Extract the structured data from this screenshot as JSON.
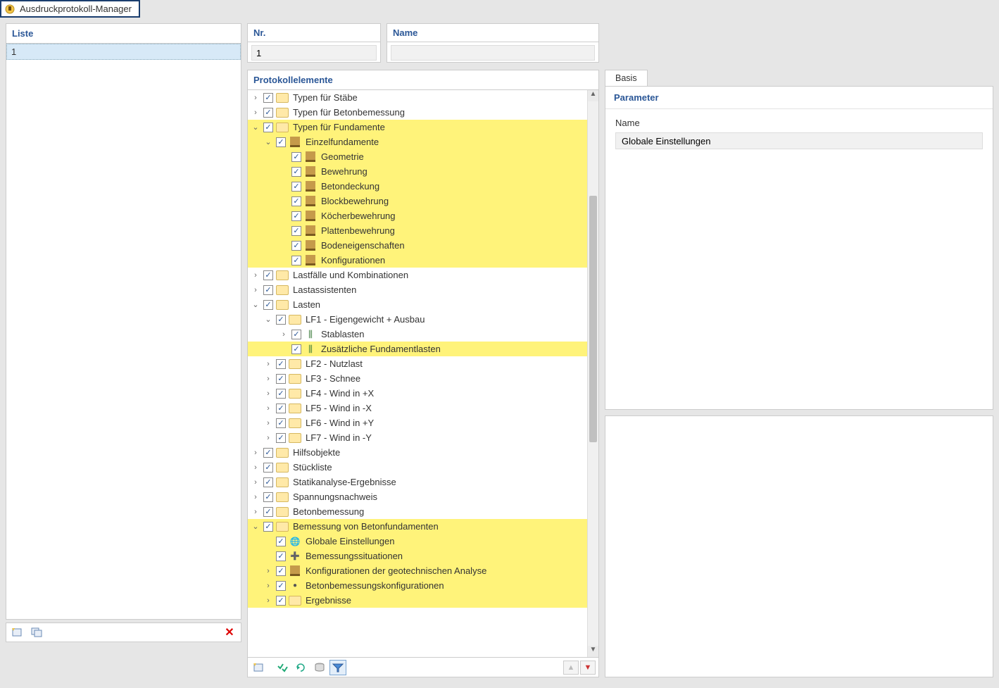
{
  "window": {
    "title": "Ausdruckprotokoll-Manager"
  },
  "liste": {
    "header": "Liste",
    "items": [
      "1"
    ]
  },
  "mid": {
    "nr_header": "Nr.",
    "nr_value": "1",
    "name_header": "Name",
    "name_value": ""
  },
  "proto": {
    "header": "Protokollelemente",
    "tree": [
      {
        "lvl": 0,
        "twist": ">",
        "ico": "folder",
        "label": "Typen für Stäbe",
        "hl": false
      },
      {
        "lvl": 0,
        "twist": ">",
        "ico": "folder",
        "label": "Typen für Betonbemessung",
        "hl": false
      },
      {
        "lvl": 0,
        "twist": "v",
        "ico": "folder",
        "label": "Typen für Fundamente",
        "hl": true
      },
      {
        "lvl": 1,
        "twist": "v",
        "ico": "found",
        "label": "Einzelfundamente",
        "hl": true
      },
      {
        "lvl": 2,
        "twist": " ",
        "ico": "found",
        "label": "Geometrie",
        "hl": true
      },
      {
        "lvl": 2,
        "twist": " ",
        "ico": "found",
        "label": "Bewehrung",
        "hl": true
      },
      {
        "lvl": 2,
        "twist": " ",
        "ico": "found",
        "label": "Betondeckung",
        "hl": true
      },
      {
        "lvl": 2,
        "twist": " ",
        "ico": "found",
        "label": "Blockbewehrung",
        "hl": true
      },
      {
        "lvl": 2,
        "twist": " ",
        "ico": "found",
        "label": "Köcherbewehrung",
        "hl": true
      },
      {
        "lvl": 2,
        "twist": " ",
        "ico": "found",
        "label": "Plattenbewehrung",
        "hl": true
      },
      {
        "lvl": 2,
        "twist": " ",
        "ico": "found",
        "label": "Bodeneigenschaften",
        "hl": true
      },
      {
        "lvl": 2,
        "twist": " ",
        "ico": "found",
        "label": "Konfigurationen",
        "hl": true
      },
      {
        "lvl": 0,
        "twist": ">",
        "ico": "folder",
        "label": "Lastfälle und Kombinationen",
        "hl": false
      },
      {
        "lvl": 0,
        "twist": ">",
        "ico": "folder",
        "label": "Lastassistenten",
        "hl": false
      },
      {
        "lvl": 0,
        "twist": "v",
        "ico": "folder",
        "label": "Lasten",
        "hl": false
      },
      {
        "lvl": 1,
        "twist": "v",
        "ico": "folder",
        "label": "LF1 - Eigengewicht + Ausbau",
        "hl": false
      },
      {
        "lvl": 2,
        "twist": ">",
        "ico": "bar",
        "label": "Stablasten",
        "hl": false
      },
      {
        "lvl": 2,
        "twist": " ",
        "ico": "bar",
        "label": "Zusätzliche Fundamentlasten",
        "hl": true
      },
      {
        "lvl": 1,
        "twist": ">",
        "ico": "folder",
        "label": "LF2 - Nutzlast",
        "hl": false
      },
      {
        "lvl": 1,
        "twist": ">",
        "ico": "folder",
        "label": "LF3 - Schnee",
        "hl": false
      },
      {
        "lvl": 1,
        "twist": ">",
        "ico": "folder",
        "label": "LF4 - Wind in +X",
        "hl": false
      },
      {
        "lvl": 1,
        "twist": ">",
        "ico": "folder",
        "label": "LF5 - Wind in -X",
        "hl": false
      },
      {
        "lvl": 1,
        "twist": ">",
        "ico": "folder",
        "label": "LF6 - Wind in +Y",
        "hl": false
      },
      {
        "lvl": 1,
        "twist": ">",
        "ico": "folder",
        "label": "LF7 - Wind in -Y",
        "hl": false
      },
      {
        "lvl": 0,
        "twist": ">",
        "ico": "folder",
        "label": "Hilfsobjekte",
        "hl": false
      },
      {
        "lvl": 0,
        "twist": ">",
        "ico": "folder",
        "label": "Stückliste",
        "hl": false
      },
      {
        "lvl": 0,
        "twist": ">",
        "ico": "folder",
        "label": "Statikanalyse-Ergebnisse",
        "hl": false
      },
      {
        "lvl": 0,
        "twist": ">",
        "ico": "folder",
        "label": "Spannungsnachweis",
        "hl": false
      },
      {
        "lvl": 0,
        "twist": ">",
        "ico": "folder",
        "label": "Betonbemessung",
        "hl": false
      },
      {
        "lvl": 0,
        "twist": "v",
        "ico": "folder",
        "label": "Bemessung von Betonfundamenten",
        "hl": true
      },
      {
        "lvl": 1,
        "twist": " ",
        "ico": "globe",
        "label": "Globale Einstellungen",
        "hl": true
      },
      {
        "lvl": 1,
        "twist": " ",
        "ico": "design",
        "label": "Bemessungssituationen",
        "hl": true
      },
      {
        "lvl": 1,
        "twist": ">",
        "ico": "found",
        "label": "Konfigurationen der geotechnischen Analyse",
        "hl": true
      },
      {
        "lvl": 1,
        "twist": ">",
        "ico": "dot",
        "label": "Betonbemessungskonfigurationen",
        "hl": true
      },
      {
        "lvl": 1,
        "twist": ">",
        "ico": "folder",
        "label": "Ergebnisse",
        "hl": true
      }
    ]
  },
  "right": {
    "tabs": [
      "Basis"
    ],
    "param_header": "Parameter",
    "name_label": "Name",
    "name_value": "Globale Einstellungen"
  }
}
